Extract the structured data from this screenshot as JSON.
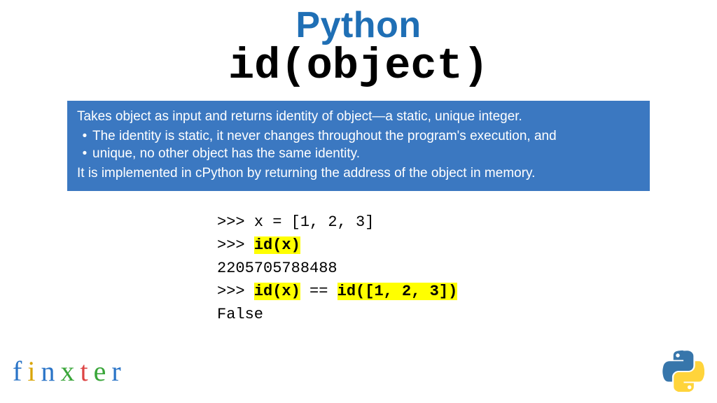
{
  "title": {
    "python": "Python",
    "func": "id(object)"
  },
  "description": {
    "intro": "Takes object as input and returns identity of object—a static, unique integer.",
    "bullets": [
      "The identity is static, it never changes throughout the program's execution, and",
      "unique, no other object has the same identity."
    ],
    "outro": "It is implemented in cPython by returning the address of the object in memory."
  },
  "code": {
    "prompt": ">>> ",
    "line1_rest": "x = [1, 2, 3]",
    "line2_id": "id",
    "line2_rest": "(x)",
    "line3": "2205705788488",
    "line4_id1": "id",
    "line4_mid1": "(x)",
    "line4_eq": " == ",
    "line4_id2": "id",
    "line4_mid2": "([1, 2, 3])",
    "line5": "False"
  },
  "logo": {
    "f": "f",
    "i": "i",
    "n": "n",
    "x": "x",
    "t": "t",
    "e": "e",
    "r": "r"
  }
}
